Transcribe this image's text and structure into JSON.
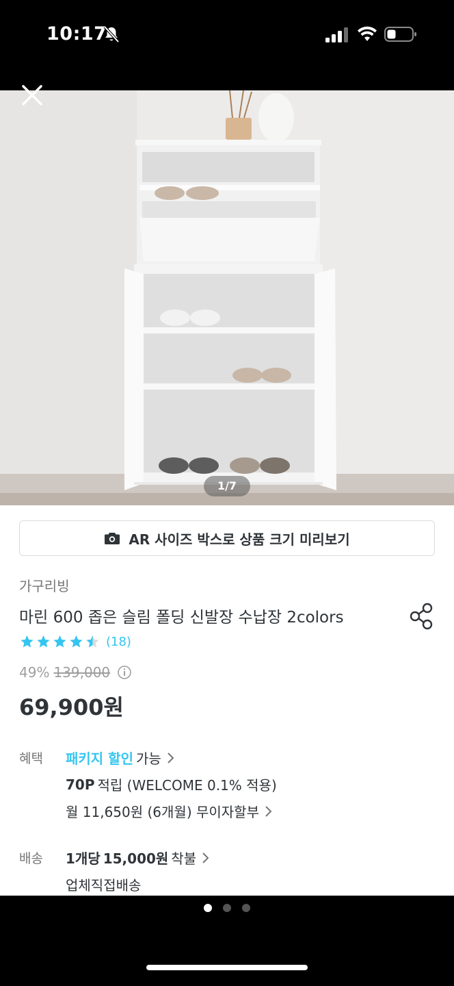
{
  "status_bar": {
    "time": "10:17"
  },
  "gallery": {
    "page_indicator": "1/7",
    "current_page": 1,
    "total_pages": 7
  },
  "ar_button": {
    "label": "AR 사이즈 박스로 상품 크기 미리보기"
  },
  "product": {
    "brand": "가구리빙",
    "title": "마린 600 좁은 슬림 폴딩 신발장 수납장 2colors",
    "rating_stars": 4.5,
    "review_count": "(18)",
    "discount": "49%",
    "original_price": "139,000",
    "price": "69,900원"
  },
  "benefits": {
    "label": "혜택",
    "package_link": "패키지 할인",
    "package_suffix": "가능",
    "points_bold": "70P",
    "points_text": "적립 (WELCOME 0.1% 적용)",
    "installment": "월 11,650원 (6개월) 무이자할부"
  },
  "shipping": {
    "label": "배송",
    "fee_prefix": "1개당",
    "fee_amount": "15,000원",
    "fee_suffix": "착불",
    "method": "업체직접배송"
  },
  "pager_dots": {
    "count": 3,
    "active_index": 0
  },
  "colors": {
    "accent": "#35c5f0",
    "text": "#2f3438",
    "muted": "#757575"
  }
}
